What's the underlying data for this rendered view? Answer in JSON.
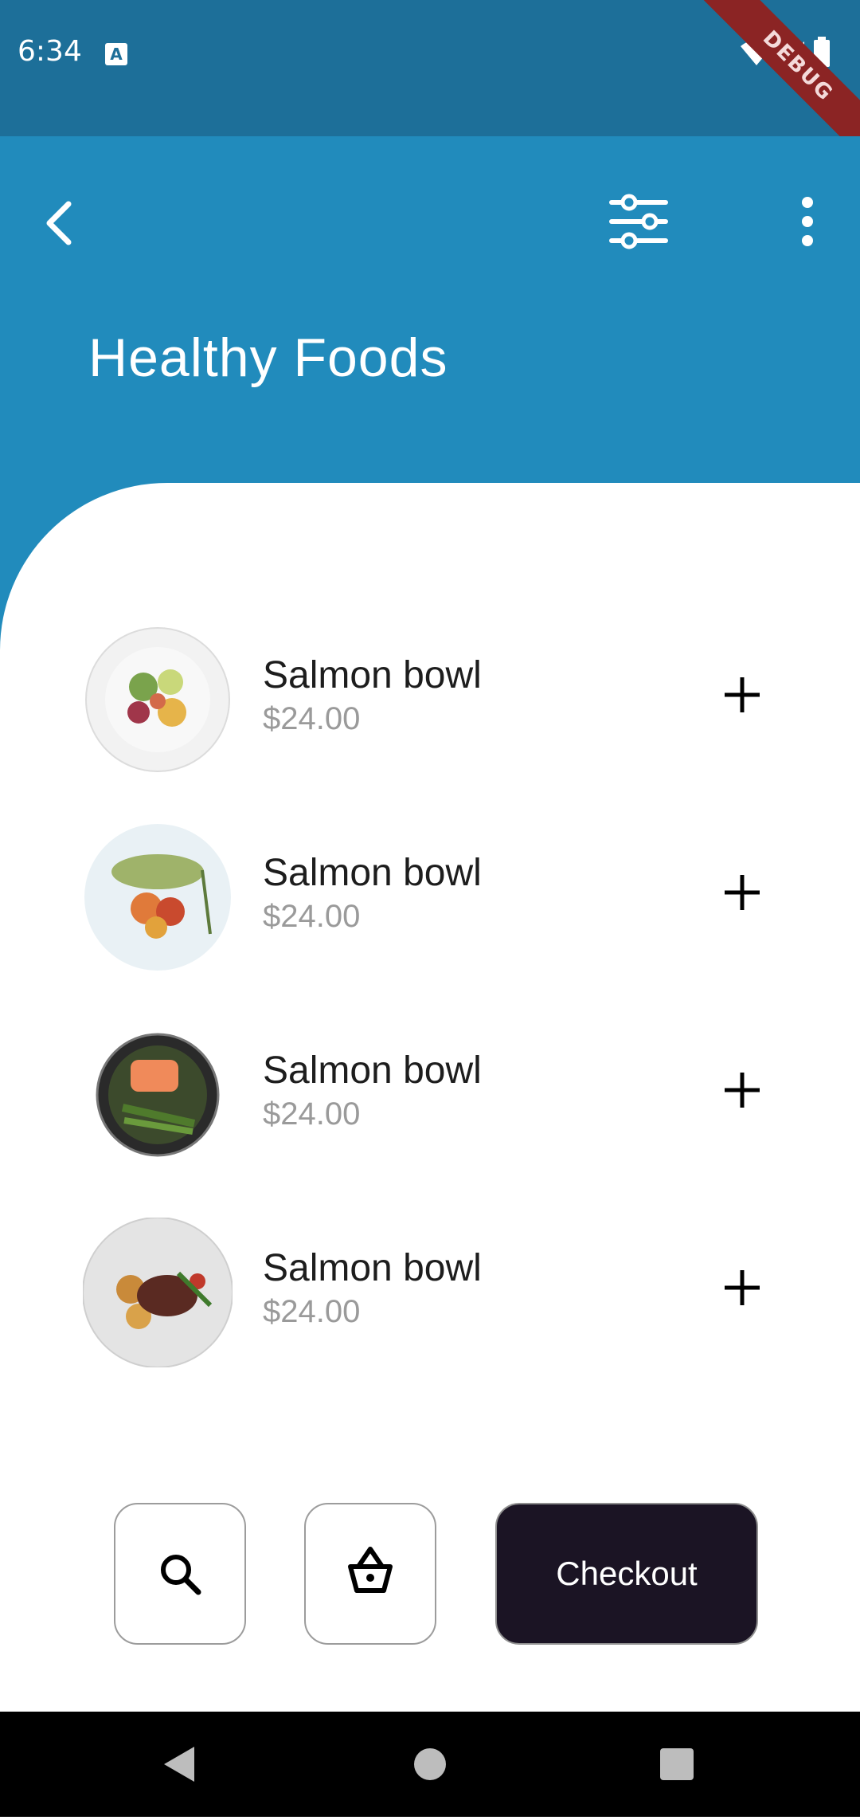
{
  "status_bar": {
    "time": "6:34",
    "notification_icon": "a-icon",
    "debug_label": "DEBUG"
  },
  "header": {
    "title": "Healthy Foods",
    "back_icon": "chevron-left-icon",
    "filter_icon": "sliders-icon",
    "more_icon": "more-vertical-icon",
    "background_color": "#218bbc"
  },
  "items": [
    {
      "name": "Salmon bowl",
      "price": "$24.00"
    },
    {
      "name": "Salmon bowl",
      "price": "$24.00"
    },
    {
      "name": "Salmon bowl",
      "price": "$24.00"
    },
    {
      "name": "Salmon bowl",
      "price": "$24.00"
    }
  ],
  "bottom_bar": {
    "search_icon": "search-icon",
    "basket_icon": "basket-icon",
    "checkout_label": "Checkout",
    "checkout_color": "#1b1424"
  }
}
